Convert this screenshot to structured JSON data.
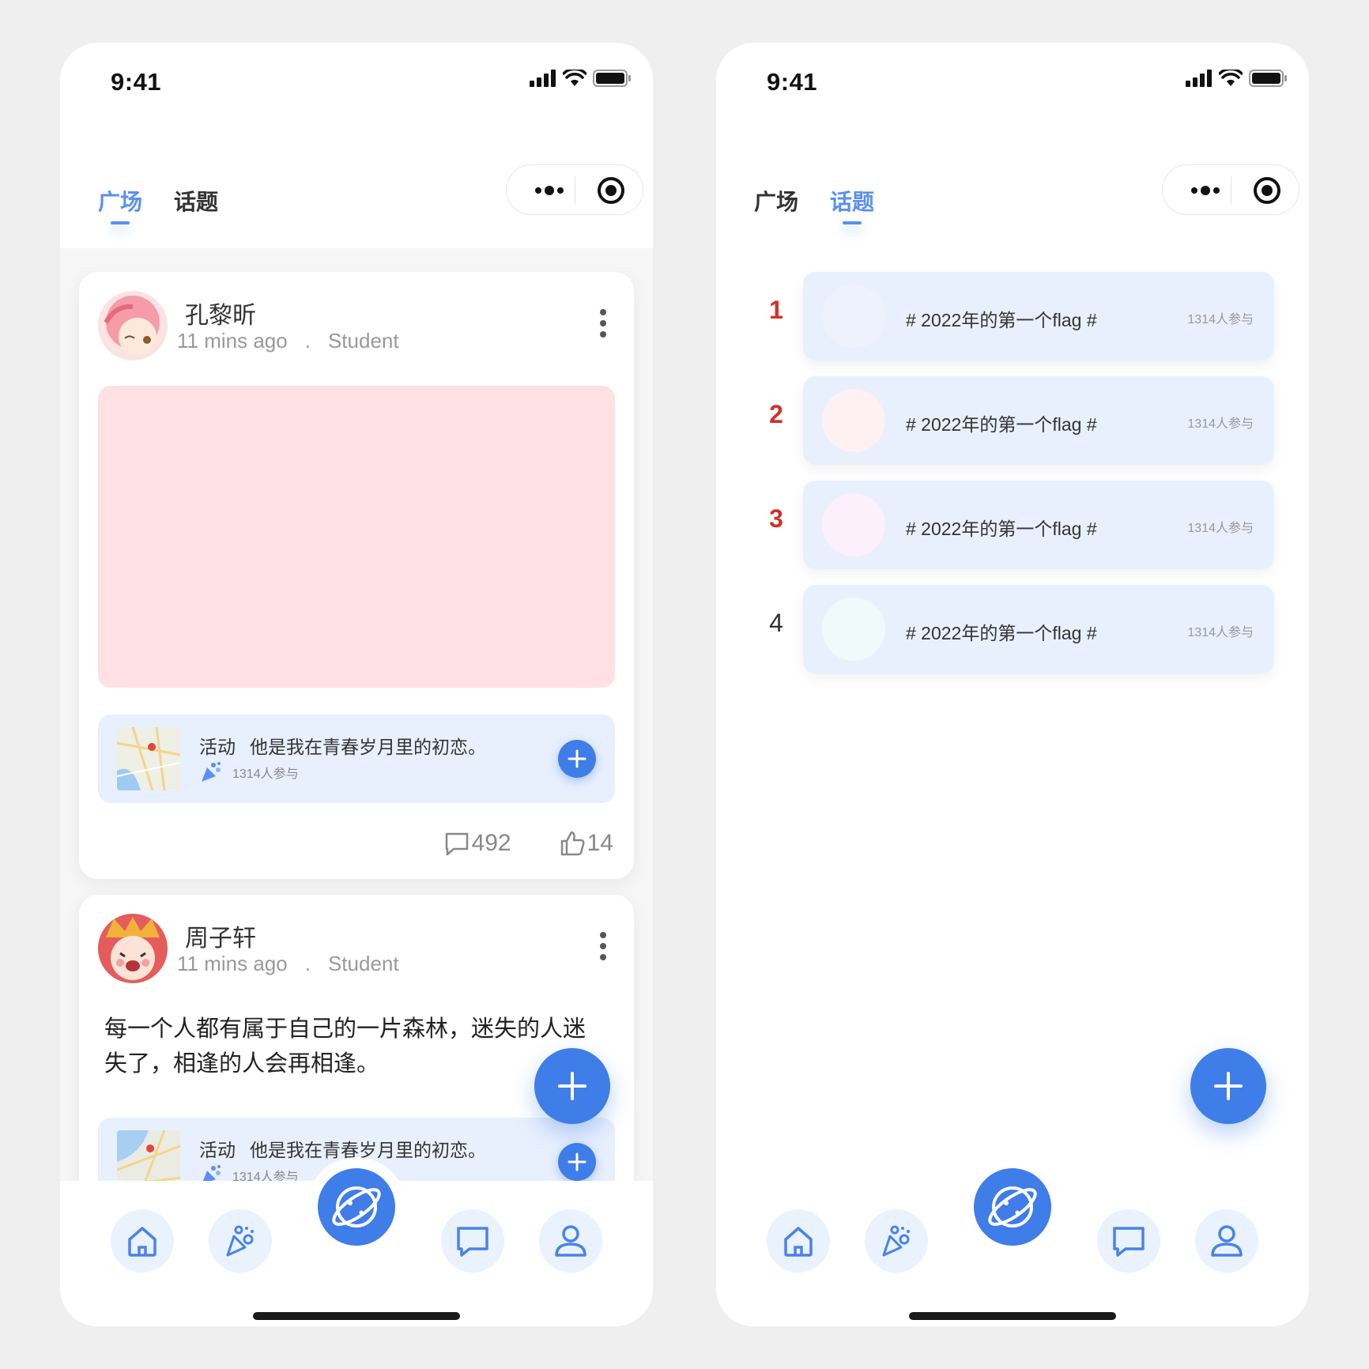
{
  "status": {
    "time": "9:41"
  },
  "tabs": {
    "plaza": "广场",
    "topics": "话题"
  },
  "posts": [
    {
      "author": "孔黎昕",
      "time_ago": "11 mins ago",
      "dot": ".",
      "role": "Student",
      "activity": {
        "tag": "活动",
        "text": "他是我在青春岁月里的初恋。",
        "participants": "1314人参与"
      },
      "comments": "492",
      "likes": "14"
    },
    {
      "author": "周子轩",
      "time_ago": "11 mins ago",
      "dot": ".",
      "role": "Student",
      "content": "每一个人都有属于自己的一片森林，迷失的人迷失了，相逢的人会再相逢。",
      "activity": {
        "tag": "活动",
        "text": "他是我在青春岁月里的初恋。",
        "participants": "1314人参与"
      }
    }
  ],
  "topic_list": [
    {
      "rank": "1",
      "title": "# 2022年的第一个flag #",
      "participants": "1314人参与",
      "circle_color": "#eef2fc"
    },
    {
      "rank": "2",
      "title": "# 2022年的第一个flag #",
      "participants": "1314人参与",
      "circle_color": "#fdf1f1"
    },
    {
      "rank": "3",
      "title": "# 2022年的第一个flag #",
      "participants": "1314人参与",
      "circle_color": "#fbf0fb"
    },
    {
      "rank": "4",
      "title": "# 2022年的第一个flag #",
      "participants": "1314人参与",
      "circle_color": "#f0fafa"
    }
  ],
  "icons": {
    "status": [
      "signal-icon",
      "wifi-icon",
      "battery-icon"
    ],
    "capsule": [
      "more-dots-icon",
      "target-icon"
    ],
    "post_actions": [
      "comment-icon",
      "thumbs-up-icon",
      "kebab-menu-icon"
    ],
    "activity": [
      "map-thumbnail",
      "party-popper-icon",
      "plus-icon"
    ],
    "nav": [
      "home-icon",
      "party-popper-icon",
      "planet-icon",
      "chat-icon",
      "user-icon"
    ]
  },
  "colors": {
    "accent": "#3f7de8",
    "tab_active": "#5b8ff0",
    "rank_top": "#d2312b",
    "card_tint": "#e8f0fd",
    "image_placeholder": "#ffe1e3"
  }
}
